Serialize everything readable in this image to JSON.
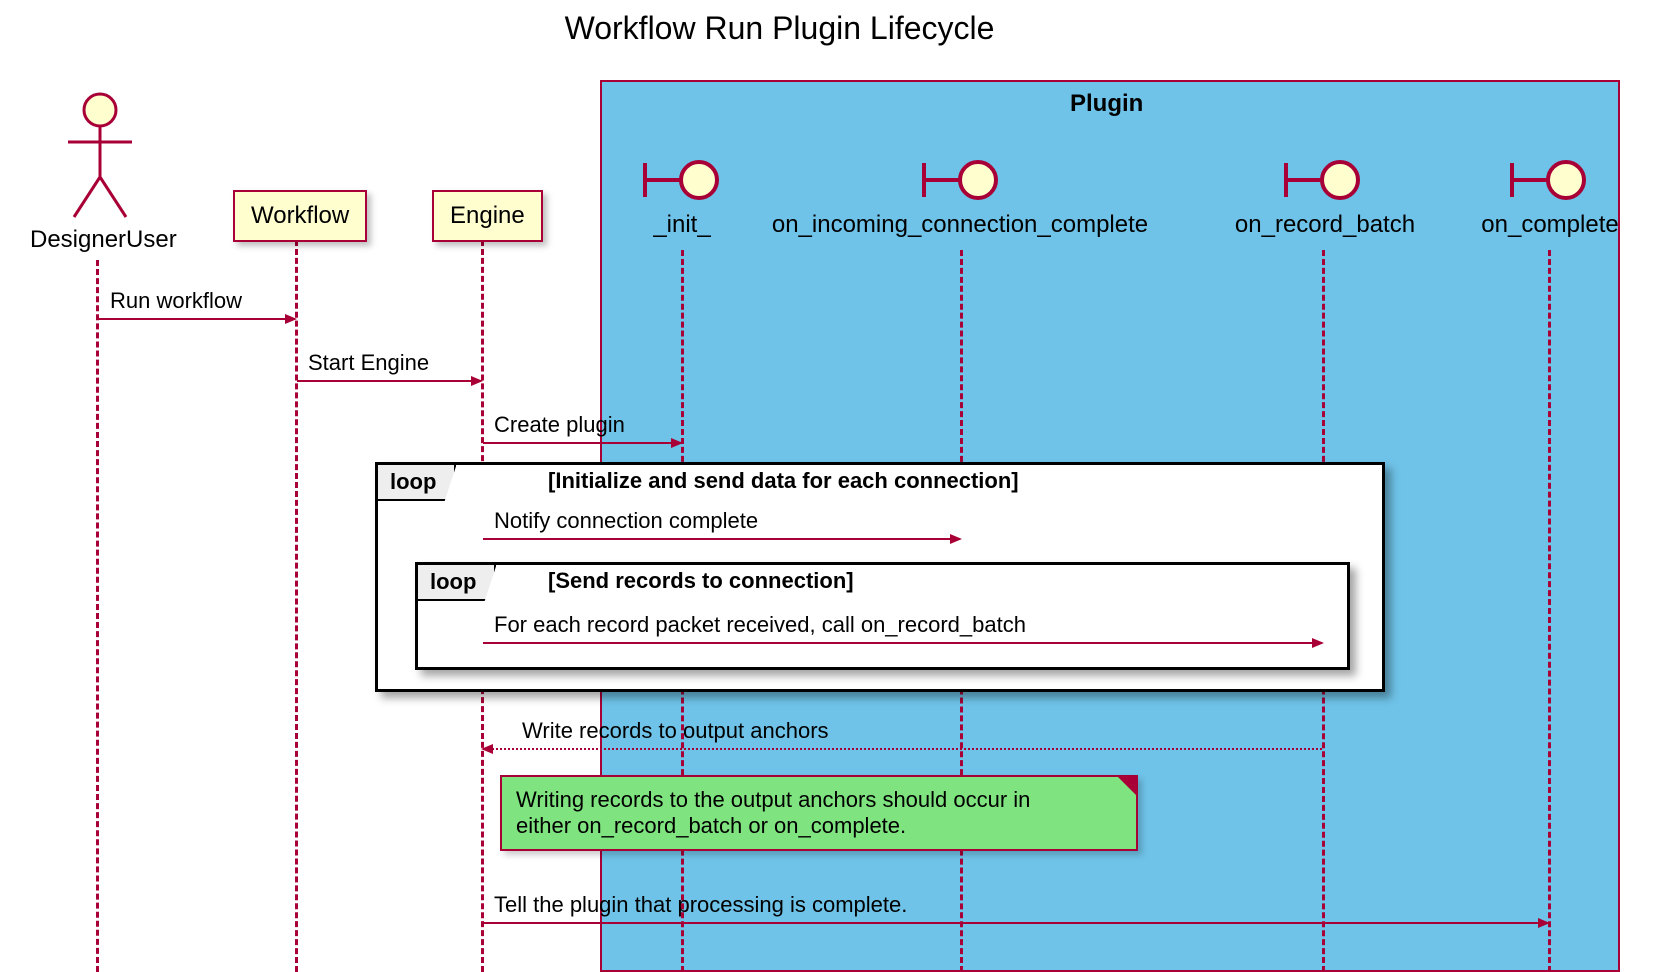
{
  "title": "Workflow Run Plugin Lifecycle",
  "participants": {
    "actor": "DesignerUser",
    "workflow": "Workflow",
    "engine": "Engine",
    "plugin_group": "Plugin",
    "init": "_init_",
    "on_incoming": "on_incoming_connection_complete",
    "on_record_batch": "on_record_batch",
    "on_complete": "on_complete"
  },
  "messages": {
    "run_workflow": "Run workflow",
    "start_engine": "Start Engine",
    "create_plugin": "Create plugin",
    "notify_conn": "Notify connection complete",
    "each_packet": "For each record packet received, call on_record_batch",
    "write_records": "Write records to output anchors",
    "tell_complete": "Tell the plugin that processing is complete."
  },
  "loops": {
    "outer_label": "loop",
    "outer_cond": "[Initialize and send data for each connection]",
    "inner_label": "loop",
    "inner_cond": "[Send records to connection]"
  },
  "note": {
    "line1": "Writing records to the output anchors should occur in",
    "line2": "either on_record_batch or on_complete."
  },
  "chart_data": {
    "type": "sequence_diagram",
    "title": "Workflow Run Plugin Lifecycle",
    "participants": [
      {
        "name": "DesignerUser",
        "kind": "actor"
      },
      {
        "name": "Workflow",
        "kind": "participant"
      },
      {
        "name": "Engine",
        "kind": "participant"
      },
      {
        "name": "Plugin",
        "kind": "box",
        "contains": [
          "_init_",
          "on_incoming_connection_complete",
          "on_record_batch",
          "on_complete"
        ]
      },
      {
        "name": "_init_",
        "kind": "boundary"
      },
      {
        "name": "on_incoming_connection_complete",
        "kind": "boundary"
      },
      {
        "name": "on_record_batch",
        "kind": "boundary"
      },
      {
        "name": "on_complete",
        "kind": "boundary"
      }
    ],
    "interactions": [
      {
        "from": "DesignerUser",
        "to": "Workflow",
        "label": "Run workflow",
        "style": "solid"
      },
      {
        "from": "Workflow",
        "to": "Engine",
        "label": "Start Engine",
        "style": "solid"
      },
      {
        "from": "Engine",
        "to": "_init_",
        "label": "Create plugin",
        "style": "solid"
      },
      {
        "type": "loop",
        "condition": "Initialize and send data for each connection",
        "body": [
          {
            "from": "Engine",
            "to": "on_incoming_connection_complete",
            "label": "Notify connection complete",
            "style": "solid"
          },
          {
            "type": "loop",
            "condition": "Send records to connection",
            "body": [
              {
                "from": "Engine",
                "to": "on_record_batch",
                "label": "For each record packet received, call on_record_batch",
                "style": "solid"
              }
            ]
          }
        ]
      },
      {
        "from": "on_record_batch",
        "to": "Engine",
        "label": "Write records to output anchors",
        "style": "dotted"
      },
      {
        "type": "note",
        "over": [
          "Engine",
          "on_record_batch"
        ],
        "text": "Writing records to the output anchors should occur in either on_record_batch or on_complete."
      },
      {
        "from": "Engine",
        "to": "on_complete",
        "label": "Tell the plugin that processing is complete.",
        "style": "solid"
      }
    ]
  }
}
